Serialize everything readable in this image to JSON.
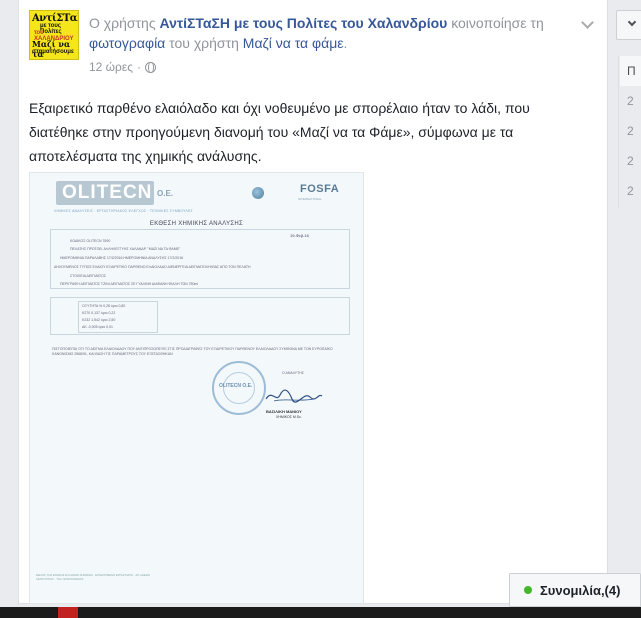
{
  "post": {
    "prefix": "Ο χρήστης",
    "author": "ΑντίΣΤαΣΗ με τους Πολίτες του Χαλανδρίου",
    "shared": "κοινοποίησε τη",
    "photo_link": "φωτογραφία",
    "of_user": "του χρήστη",
    "source_user": "Μαζί να τα φάμε",
    "period": ".",
    "time": "12 ώρες",
    "separator": "·",
    "body": "Εξαιρετικό παρθένο ελαιόλαδο και όχι νοθευμένο με σπορέλαιο ήταν το λάδι, που διατέθηκε στην προηγούμενη διανομή του «Μαζί να τα Φάμε», σύμφωνα με τα αποτελέσματα της χημικής ανάλυσης."
  },
  "avatar": {
    "line1": "ΑντίΣΤαΣΗ",
    "line2": "με τους Πολίτες",
    "line3": "του ΧΑΛΑΝΔΡΙΟΥ",
    "line4": "Μαζί να τα",
    "line5": "σταματήσουμε"
  },
  "document": {
    "logo": "OLITECN",
    "logo_suffix": "Ο.Ε.",
    "logo_sub": "ΧΗΜΙΚΕΣ ΑΝΑΛΥΣΕΙΣ · ΕΡΓΑΣΤΗΡΙΑΚΟΣ ΕΛΕΓΧΟΣ · ΤΕΧΝΙΚΕΣ ΣΥΜΒΟΥΛΕΣ",
    "fosfa": "FOSFA",
    "fosfa_sub": "INTERNATIONAL",
    "title": "ΕΚΘΕΣΗ ΧΗΜΙΚΗΣ ΑΝΑΛΥΣΗΣ",
    "date": "19-Φεβ-16",
    "rows": [
      "ΚΩΔΙΚΟΣ OLITECN   7690",
      "ΠΕΛΑΤΗΣ   ΠΡΩΤΟΒ. ΑΛΛΗΛΕΓΓΥΗΣ ΧΑΛΑΝΔΡ. \"ΜΑΖΙ ΝΑ ΤΑ ΦΑΜΕ\"",
      "ΗΜΕΡΟΜΗΝΙΑ ΠΑΡΑΛΑΒΗΣ   17/2/2016          ΗΜΕΡΟΜΗΝΙΑ ΑΝΑΛΥΣΗΣ   17/2/2016",
      "ΔΗΛΟΥΜΕΝΟΣ ΤΥΠΟΣ ΕΛΑΙΟΥ   ΕΞΑΙΡΕΤΙΚΟ ΠΑΡΘΕΝΟ ΕΛΑΙΟΛΑΔΟ          ΔΙΕΝΕΡΓΕΙΑ ΔΕΙΓΜΑΤΟΛΗΨΙΑΣ   ΑΠΟ ΤΟΝ ΠΕΛΑΤΗ",
      "ΣΤΟΙΧΕΙΑ ΔΕΙΓΜΑΤΟΣ",
      "ΠΕΡΙΓΡΑΦΗ ΔΕΙΓΜΑΤΟΣ   ΤΖΙΝΙ ΔΕΙΓΜΑΤΟΣ ΣΕ ΓΥΑΛΙΝΗ ΔΙΑΦΑΝΗ ΦΙΑΛΗ ΤΩΝ 750ml"
    ],
    "results": [
      "ΟΞΥΤΗΤΑ %   0,28      όριο 0,80",
      "K270   0,137      όριο 0,22",
      "K232   1,542      όριο 2,50",
      "ΔK   -0,005      όριο 0,01"
    ],
    "note": "ΠΙΣΤΟΠΟΙΕΙΤΑΙ ΟΤΙ ΤΟ ΔΕΙΓΜΑ ΕΛΑΙΟΛΑΔΟΥ ΠΟΥ ΑΝΤΙΠΡΟΣΩΠΕΥΕΙ ΣΤΙΣ ΠΡΟΔΙΑΓΡΑΦΕΣ ΤΟΥ ΕΞΑΙΡΕΤΙΚΟΥ ΠΑΡΘΕΝΟΥ ΕΛΑΙΟΛΑΔΟΥ ΣΥΜΦΩΝΑ ΜΕ ΤΟΝ ΕΥΡΩΠΑΪΚΟ ΚΑΝΟΝΙΣΜΟ 2568/91, ΚΑΙ ΒΑΣΗ ΤΙΣ ΠΑΡΑΜΕΤΡΟΥΣ ΤΟΥ ΕΞΕΤΑΣΘΗΚΑΝ",
    "stamp": "OLITECN Ο.Ε.",
    "analyst_label": "Ο ΑΝΑΛΥΤΗΣ",
    "analyst_name": "ΒΑΣΙΛΙΚΗ ΜΑΝΙΟΥ",
    "analyst_role": "ΧΗΜΙΚΟΣ M.Sc.",
    "footer": "ΜΕΛΟΣ ΤΗΣ ΕΝΩΣΗΣ ΕΛΛΗΝΩΝ ΧΗΜΙΚΩΝ · ΕΓΚΕΚΡΙΜΕΝΟ ΕΡΓΑΣΤΗΡΙΟ · ΑΡ. ΑΔΕΙΑΣ ΛΕΙΤΟΥΡΓΙΑΣ · ΤΗΛ. ΕΠΙΚΟΙΝΩΝΙΑΣ"
  },
  "sidebar": {
    "nums": [
      "Π",
      "2",
      "2",
      "2",
      "2"
    ]
  },
  "chat": {
    "label": "Συνομιλία,(4)",
    "dot_color": "#42b72a"
  }
}
